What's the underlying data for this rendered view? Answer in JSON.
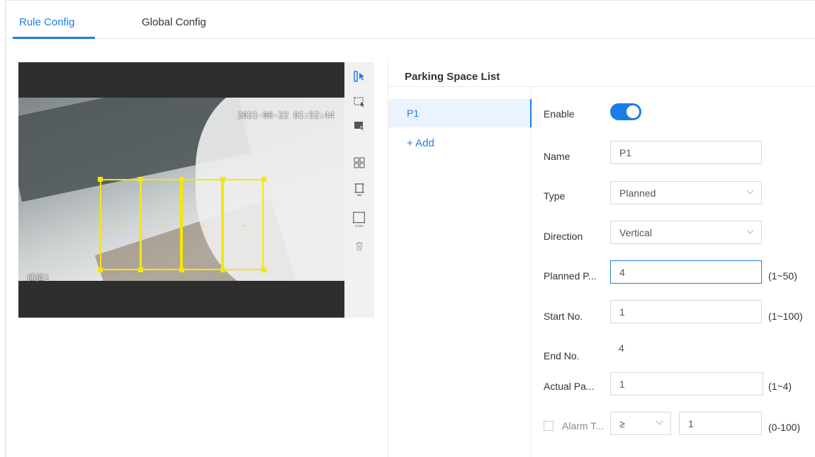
{
  "tabs": [
    {
      "label": "Rule Config",
      "active": true
    },
    {
      "label": "Global Config",
      "active": false
    }
  ],
  "video": {
    "timestamp": "2021-06-22 01:52:44",
    "channel": "通道1"
  },
  "toolbar": {
    "tools": [
      "draw-parking-space-icon",
      "select-region-icon",
      "exclude-region-icon",
      "grid-icon",
      "min-size-icon",
      "max-size-icon",
      "delete-icon"
    ],
    "max_label": "max"
  },
  "parking_panel": {
    "title": "Parking Space List",
    "items": [
      {
        "label": "P1",
        "selected": true
      }
    ],
    "add_label": "+ Add"
  },
  "form": {
    "enable_label": "Enable",
    "enable_on": true,
    "name_label": "Name",
    "name_value": "P1",
    "type_label": "Type",
    "type_value": "Planned",
    "direction_label": "Direction",
    "direction_value": "Vertical",
    "planned_label": "Planned P...",
    "planned_value": "4",
    "planned_range": "(1~50)",
    "start_label": "Start No.",
    "start_value": "1",
    "start_range": "(1~100)",
    "end_label": "End No.",
    "end_value": "4",
    "actual_label": "Actual Pa...",
    "actual_value": "1",
    "actual_range": "(1~4)",
    "alarm_label": "Alarm T...",
    "alarm_checked": false,
    "alarm_operator": "≥",
    "alarm_value": "1",
    "alarm_range": "(0-100)"
  },
  "colors": {
    "accent": "#1a7ee6",
    "space_outline": "#f5e800",
    "video_bg": "#2e2e2e"
  }
}
